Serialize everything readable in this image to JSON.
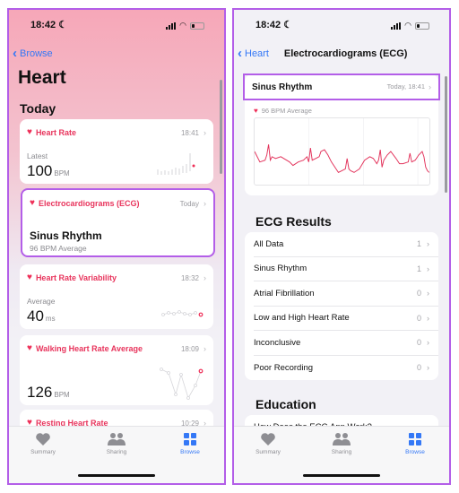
{
  "left_screen": {
    "status": {
      "time": "18:42"
    },
    "back_label": "Browse",
    "title": "Heart",
    "section": "Today",
    "cards": [
      {
        "title": "Heart Rate",
        "time": "18:41",
        "sub": "Latest",
        "value": "100",
        "unit": "BPM"
      },
      {
        "title": "Electrocardiograms (ECG)",
        "time": "Today",
        "result": "Sinus Rhythm",
        "sub": "96 BPM Average"
      },
      {
        "title": "Heart Rate Variability",
        "time": "18:32",
        "sub": "Average",
        "value": "40",
        "unit": "ms"
      },
      {
        "title": "Walking Heart Rate Average",
        "time": "18:09",
        "value": "126",
        "unit": "BPM"
      },
      {
        "title": "Resting Heart Rate",
        "time": "10:29"
      }
    ]
  },
  "right_screen": {
    "status": {
      "time": "18:42"
    },
    "back_label": "Heart",
    "nav_title": "Electrocardiograms (ECG)",
    "latest": {
      "title": "Sinus Rhythm",
      "time": "Today, 18:41",
      "avg": "96 BPM Average"
    },
    "results_title": "ECG Results",
    "results": [
      {
        "label": "All Data",
        "count": "1"
      },
      {
        "label": "Sinus Rhythm",
        "count": "1"
      },
      {
        "label": "Atrial Fibrillation",
        "count": "0"
      },
      {
        "label": "Low and High Heart Rate",
        "count": "0"
      },
      {
        "label": "Inconclusive",
        "count": "0"
      },
      {
        "label": "Poor Recording",
        "count": "0"
      }
    ],
    "education_title": "Education",
    "education": [
      {
        "label": "How Does the ECG App Work?"
      }
    ]
  },
  "tabs": [
    {
      "label": "Summary",
      "icon": "heart-icon"
    },
    {
      "label": "Sharing",
      "icon": "people-icon"
    },
    {
      "label": "Browse",
      "icon": "grid-icon",
      "active": true
    }
  ],
  "colors": {
    "accent": "#3478f6",
    "heart": "#ee2f58",
    "highlight": "#b35ee8"
  }
}
